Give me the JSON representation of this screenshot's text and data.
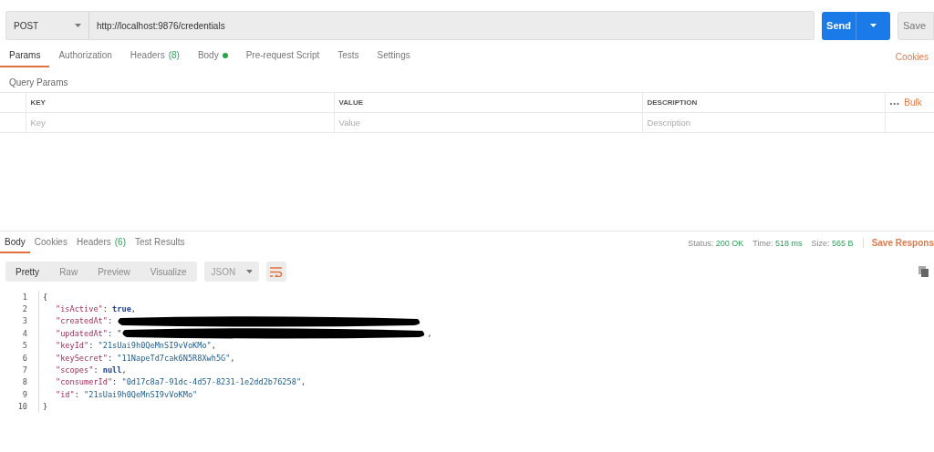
{
  "request": {
    "method": "POST",
    "url": "http://localhost:9876/credentials",
    "send": "Send",
    "save": "Save"
  },
  "request_tabs": [
    {
      "label": "Params",
      "dot": false,
      "selected": true
    },
    {
      "label": "Authorization",
      "dot": false,
      "selected": false
    },
    {
      "label": "Headers",
      "count": "(8)",
      "dot": false,
      "selected": false
    },
    {
      "label": "Body",
      "dot": true,
      "selected": false
    },
    {
      "label": "Pre-request Script",
      "dot": false,
      "selected": false
    },
    {
      "label": "Tests",
      "dot": false,
      "selected": false
    },
    {
      "label": "Settings",
      "dot": false,
      "selected": false
    }
  ],
  "cookies_link": "Cookies",
  "query_params": {
    "title": "Query Params",
    "columns": [
      "KEY",
      "VALUE",
      "DESCRIPTION"
    ],
    "more": "•••",
    "bulk_edit": "Bulk",
    "placeholders": [
      "Key",
      "Value",
      "Description"
    ]
  },
  "response_tabs": [
    {
      "label": "Body",
      "selected": true
    },
    {
      "label": "Cookies",
      "selected": false
    },
    {
      "label": "Headers",
      "count": "(6)",
      "selected": false
    },
    {
      "label": "Test Results",
      "selected": false
    }
  ],
  "response_meta": [
    {
      "label": "Status:",
      "value": "200 OK"
    },
    {
      "label": "Time:",
      "value": "518 ms"
    },
    {
      "label": "Size:",
      "value": "565 B"
    }
  ],
  "save_response": "Save Respons",
  "view_modes": [
    {
      "label": "Pretty",
      "selected": true
    },
    {
      "label": "Raw",
      "selected": false
    },
    {
      "label": "Preview",
      "selected": false
    },
    {
      "label": "Visualize",
      "selected": false
    }
  ],
  "format": "JSON",
  "code_lines": [
    {
      "number": "1",
      "tokens": [
        {
          "kind": "punct",
          "text": "{"
        }
      ]
    },
    {
      "number": "2",
      "tokens": [
        {
          "kind": "key",
          "text": "\"isActive\""
        },
        {
          "kind": "punct",
          "text": ": "
        },
        {
          "kind": "literal",
          "text": "true"
        },
        {
          "kind": "punct",
          "text": ","
        }
      ]
    },
    {
      "number": "3",
      "tokens": [
        {
          "kind": "key",
          "text": "\"createdAt\""
        },
        {
          "kind": "punct",
          "text": ": "
        },
        {
          "kind": "redacted"
        }
      ]
    },
    {
      "number": "4",
      "tokens": [
        {
          "kind": "key",
          "text": "\"updatedAt\""
        },
        {
          "kind": "punct",
          "text": ": \""
        },
        {
          "kind": "redacted"
        },
        {
          "kind": "punct",
          "text": ","
        }
      ]
    },
    {
      "number": "5",
      "tokens": [
        {
          "kind": "key",
          "text": "\"keyId\""
        },
        {
          "kind": "punct",
          "text": ": "
        },
        {
          "kind": "string",
          "text": "\"21sUai9h0QeMnSI9vVoKMo\""
        },
        {
          "kind": "punct",
          "text": ","
        }
      ]
    },
    {
      "number": "6",
      "tokens": [
        {
          "kind": "key",
          "text": "\"keySecret\""
        },
        {
          "kind": "punct",
          "text": ": "
        },
        {
          "kind": "string",
          "text": "\"11NapeTd7cak6N5R8Xwh5G\""
        },
        {
          "kind": "punct",
          "text": ","
        }
      ]
    },
    {
      "number": "7",
      "tokens": [
        {
          "kind": "key",
          "text": "\"scopes\""
        },
        {
          "kind": "punct",
          "text": ": "
        },
        {
          "kind": "literal",
          "text": "null"
        },
        {
          "kind": "punct",
          "text": ","
        }
      ]
    },
    {
      "number": "8",
      "tokens": [
        {
          "kind": "key",
          "text": "\"consumerId\""
        },
        {
          "kind": "punct",
          "text": ": "
        },
        {
          "kind": "string",
          "text": "\"0d17c8a7-91dc-4d57-8231-1e2dd2b76258\""
        },
        {
          "kind": "punct",
          "text": ","
        }
      ]
    },
    {
      "number": "9",
      "tokens": [
        {
          "kind": "key",
          "text": "\"id\""
        },
        {
          "kind": "punct",
          "text": ": "
        },
        {
          "kind": "string",
          "text": "\"21sUai9h0QeMnSI9vVoKMo\""
        }
      ]
    },
    {
      "number": "10",
      "tokens": [
        {
          "kind": "punct",
          "text": "}"
        }
      ]
    }
  ]
}
